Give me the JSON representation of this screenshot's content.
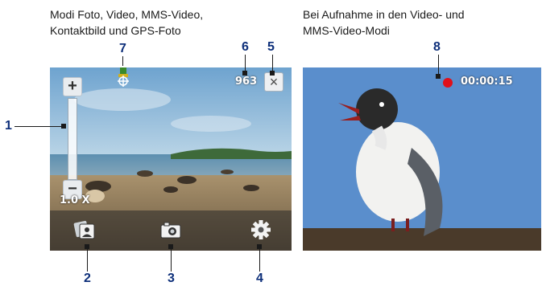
{
  "captions": {
    "left_line1": "Modi Foto, Video, MMS-Video,",
    "left_line2": "Kontaktbild und GPS-Foto",
    "right_line1": "Bei Aufnahme in den Video- und",
    "right_line2": "MMS-Video-Modi"
  },
  "callouts": [
    "1",
    "2",
    "3",
    "4",
    "5",
    "6",
    "7",
    "8"
  ],
  "left_screen": {
    "zoom_plus": "+",
    "zoom_minus": "−",
    "zoom_level": "1.0 X",
    "counter": "963",
    "close": "×",
    "toolbar_icons": [
      "mode-icon",
      "camera-icon",
      "settings-icon"
    ]
  },
  "right_screen": {
    "timer": "00:00:15",
    "record_icon_color": "#e0101a"
  },
  "colors": {
    "callout": "#0d2f7a"
  }
}
